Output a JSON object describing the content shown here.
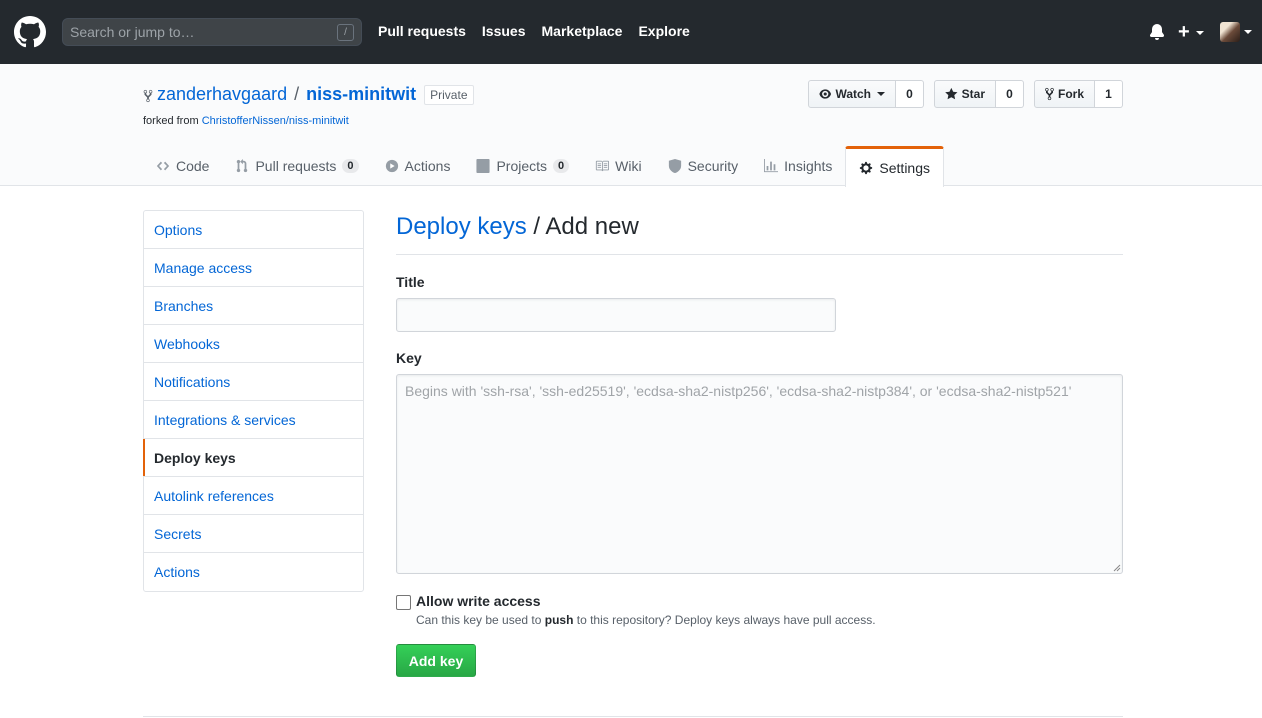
{
  "header": {
    "search_placeholder": "Search or jump to…",
    "search_shortcut": "/",
    "nav": [
      "Pull requests",
      "Issues",
      "Marketplace",
      "Explore"
    ],
    "new_label": "+"
  },
  "repo": {
    "owner": "zanderhavgaard",
    "separator": "/",
    "name": "niss-minitwit",
    "visibility": "Private",
    "forked_from_label": "forked from",
    "forked_from": "ChristofferNissen/niss-minitwit",
    "watch_label": "Watch",
    "watch_count": "0",
    "star_label": "Star",
    "star_count": "0",
    "fork_label": "Fork",
    "fork_count": "1"
  },
  "tabs": [
    {
      "label": "Code",
      "icon": "code-icon"
    },
    {
      "label": "Pull requests",
      "count": "0",
      "icon": "pull-request-icon"
    },
    {
      "label": "Actions",
      "icon": "play-icon"
    },
    {
      "label": "Projects",
      "count": "0",
      "icon": "project-icon"
    },
    {
      "label": "Wiki",
      "icon": "book-icon"
    },
    {
      "label": "Security",
      "icon": "shield-icon"
    },
    {
      "label": "Insights",
      "icon": "graph-icon"
    },
    {
      "label": "Settings",
      "icon": "gear-icon",
      "selected": true
    }
  ],
  "sidebar": {
    "items": [
      {
        "label": "Options"
      },
      {
        "label": "Manage access"
      },
      {
        "label": "Branches"
      },
      {
        "label": "Webhooks"
      },
      {
        "label": "Notifications"
      },
      {
        "label": "Integrations & services"
      },
      {
        "label": "Deploy keys",
        "active": true
      },
      {
        "label": "Autolink references"
      },
      {
        "label": "Secrets"
      },
      {
        "label": "Actions"
      }
    ]
  },
  "main": {
    "heading_link": "Deploy keys",
    "heading_rest": " / Add new",
    "title_label": "Title",
    "title_value": "",
    "key_label": "Key",
    "key_value": "",
    "key_placeholder": "Begins with 'ssh-rsa', 'ssh-ed25519', 'ecdsa-sha2-nistp256', 'ecdsa-sha2-nistp384', or 'ecdsa-sha2-nistp521'",
    "write_access_label": "Allow write access",
    "write_access_checked": false,
    "write_note_before": "Can this key be used to ",
    "write_note_bold": "push",
    "write_note_after": " to this repository? Deploy keys always have pull access.",
    "submit_label": "Add key"
  },
  "colors": {
    "header_bg": "#24292e",
    "link": "#0366d6",
    "accent_tab": "#e36209",
    "primary_button": "#28a745"
  }
}
